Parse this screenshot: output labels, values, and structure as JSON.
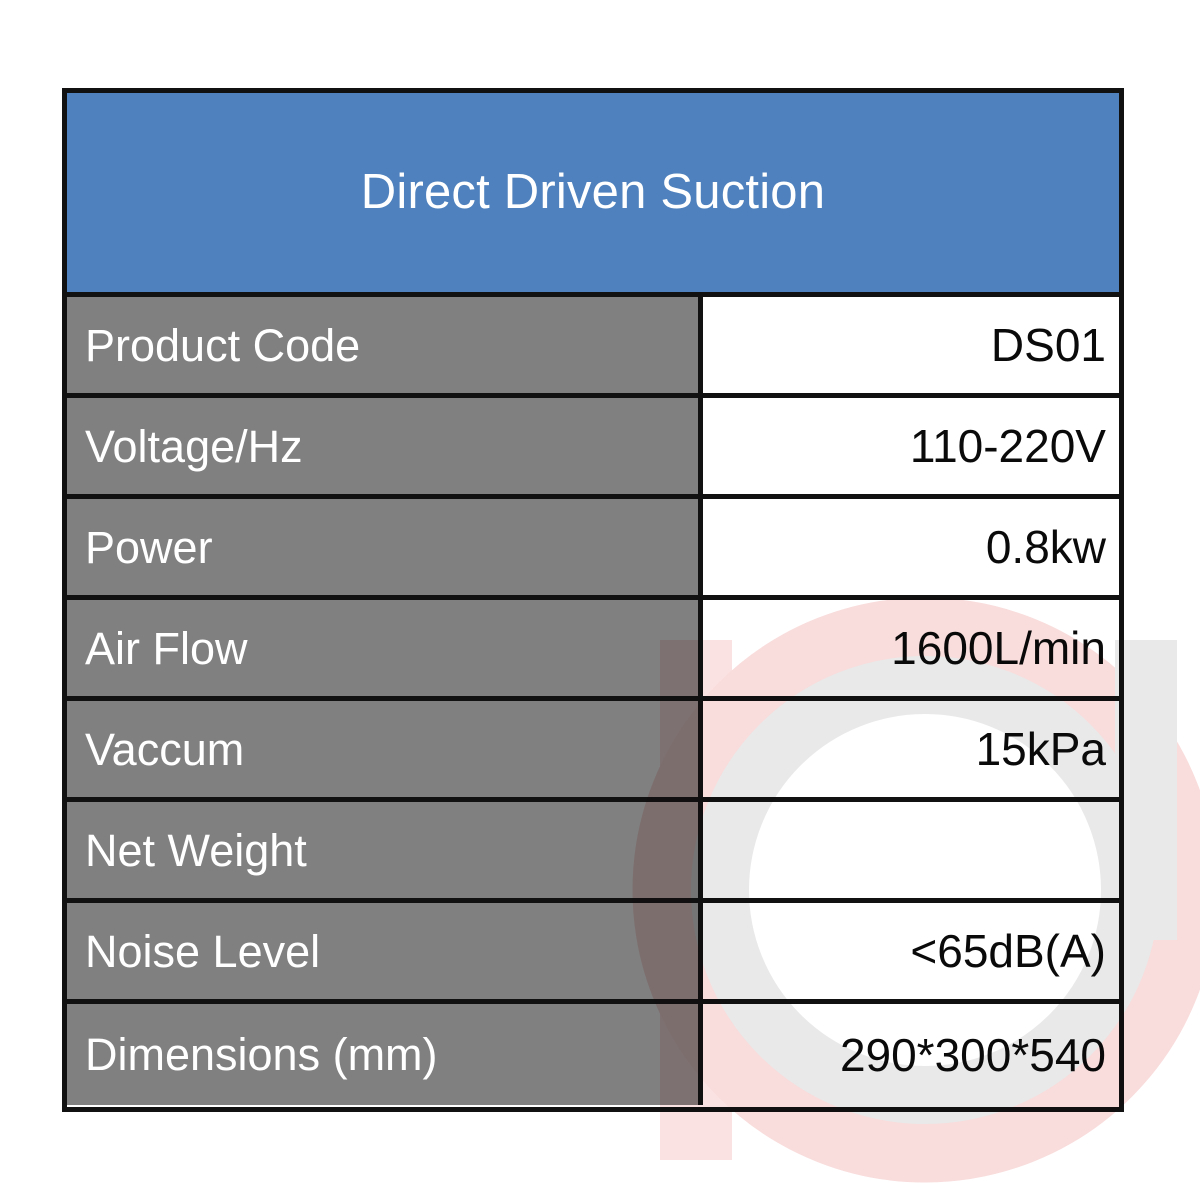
{
  "document": {
    "type": "product-specification-table",
    "background_color": "#ffffff"
  },
  "table": {
    "header": {
      "title": "Direct Driven Suction",
      "background_color": "#4E81BD",
      "text_color": "#ffffff"
    },
    "label_column": {
      "background_color": "#808080",
      "text_color": "#ffffff"
    },
    "value_column": {
      "background_color": "#ffffff",
      "text_color": "#0a0a0a"
    },
    "border_color": "#111111",
    "rows": [
      {
        "label": "Product Code",
        "value": "DS01"
      },
      {
        "label": "Voltage/Hz",
        "value": "110-220V"
      },
      {
        "label": "Power",
        "value": "0.8kw"
      },
      {
        "label": "Air Flow",
        "value": "1600L/min"
      },
      {
        "label": "Vaccum",
        "value": "15kPa"
      },
      {
        "label": "Net Weight",
        "value": ""
      },
      {
        "label": "Noise Level",
        "value": "<65dB(A)"
      },
      {
        "label": "Dimensions (mm)",
        "value": "290*300*540"
      }
    ]
  },
  "watermark": {
    "name": "logo-watermark",
    "ring_color": "#f9dcdc",
    "inner_ring_color": "#e9e9e9",
    "bar_color": "#fbe2e2"
  }
}
